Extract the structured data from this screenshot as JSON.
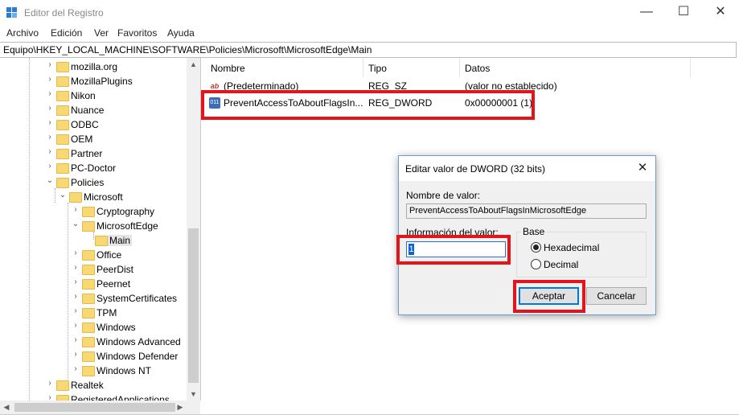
{
  "window": {
    "title": "Editor del Registro",
    "minimize_glyph": "—",
    "maximize_glyph": "☐",
    "close_glyph": "✕"
  },
  "menu": [
    "Archivo",
    "Edición",
    "Ver",
    "Favoritos",
    "Ayuda"
  ],
  "address": "Equipo\\HKEY_LOCAL_MACHINE\\SOFTWARE\\Policies\\Microsoft\\MicrosoftEdge\\Main",
  "tree": [
    {
      "label": "mozilla.org",
      "chev": "›"
    },
    {
      "label": "MozillaPlugins",
      "chev": "›"
    },
    {
      "label": "Nikon",
      "chev": "›"
    },
    {
      "label": "Nuance",
      "chev": "›"
    },
    {
      "label": "ODBC",
      "chev": "›"
    },
    {
      "label": "OEM",
      "chev": "›"
    },
    {
      "label": "Partner",
      "chev": "›"
    },
    {
      "label": "PC-Doctor",
      "chev": "›"
    },
    {
      "label": "Policies",
      "chev": "⌄"
    },
    {
      "label": "Microsoft",
      "chev": "⌄"
    },
    {
      "label": "Cryptography",
      "chev": "›"
    },
    {
      "label": "MicrosoftEdge",
      "chev": "⌄"
    },
    {
      "label": "Main",
      "chev": ""
    },
    {
      "label": "Office",
      "chev": "›"
    },
    {
      "label": "PeerDist",
      "chev": "›"
    },
    {
      "label": "Peernet",
      "chev": "›"
    },
    {
      "label": "SystemCertificates",
      "chev": "›"
    },
    {
      "label": "TPM",
      "chev": "›"
    },
    {
      "label": "Windows",
      "chev": "›"
    },
    {
      "label": "Windows Advanced",
      "chev": "›"
    },
    {
      "label": "Windows Defender",
      "chev": "›"
    },
    {
      "label": "Windows NT",
      "chev": "›"
    },
    {
      "label": "Realtek",
      "chev": "›"
    },
    {
      "label": "RegisteredApplications",
      "chev": "›"
    }
  ],
  "columns": {
    "name": "Nombre",
    "type": "Tipo",
    "data": "Datos"
  },
  "values": [
    {
      "name": "(Predeterminado)",
      "type": "REG_SZ",
      "data": "(valor no establecido)",
      "icon": "ab"
    },
    {
      "name": "PreventAccessToAboutFlagsIn...",
      "type": "REG_DWORD",
      "data": "0x00000001 (1)",
      "icon": "011"
    }
  ],
  "dialog": {
    "title": "Editar valor de DWORD (32 bits)",
    "close_glyph": "✕",
    "value_name_label": "Nombre de valor:",
    "value_name": "PreventAccessToAboutFlagsInMicrosoftEdge",
    "value_data_label": "Información del valor:",
    "value_data": "1",
    "base_label": "Base",
    "radio_hex": "Hexadecimal",
    "radio_dec": "Decimal",
    "ok": "Aceptar",
    "cancel": "Cancelar"
  },
  "colors": {
    "highlight": "#e3151a",
    "accent": "#0078d7",
    "folder": "#f8d775"
  }
}
